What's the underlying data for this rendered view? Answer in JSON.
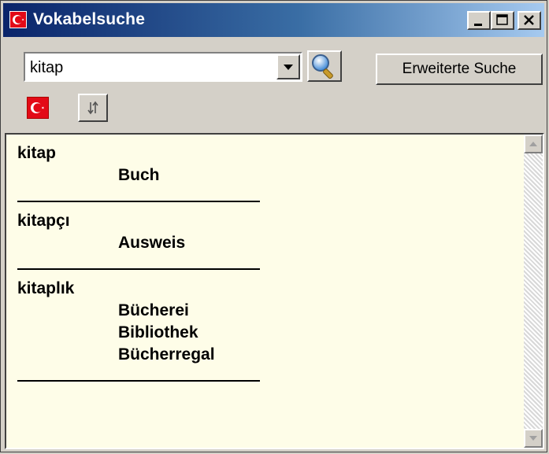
{
  "window": {
    "title": "Vokabelsuche",
    "accent": "#0a246a",
    "icon": "turkish-flag-icon"
  },
  "titlebar_buttons": {
    "minimize": "_",
    "maximize": "□",
    "close": "×"
  },
  "search": {
    "value": "kitap",
    "advanced_label": "Erweiterte Suche",
    "search_icon": "magnifier-icon",
    "language_icon": "turkish-flag-icon",
    "swap_icon": "swap-arrows-icon"
  },
  "results": [
    {
      "term": "kitap",
      "translations": [
        "Buch"
      ]
    },
    {
      "term": "kitapçı",
      "translations": [
        "Ausweis"
      ]
    },
    {
      "term": "kitaplık",
      "translations": [
        "Bücherei",
        "Bibliothek",
        "Bücherregal"
      ]
    }
  ],
  "colors": {
    "content_bg": "#fefde8",
    "flag_red": "#e30a17"
  }
}
